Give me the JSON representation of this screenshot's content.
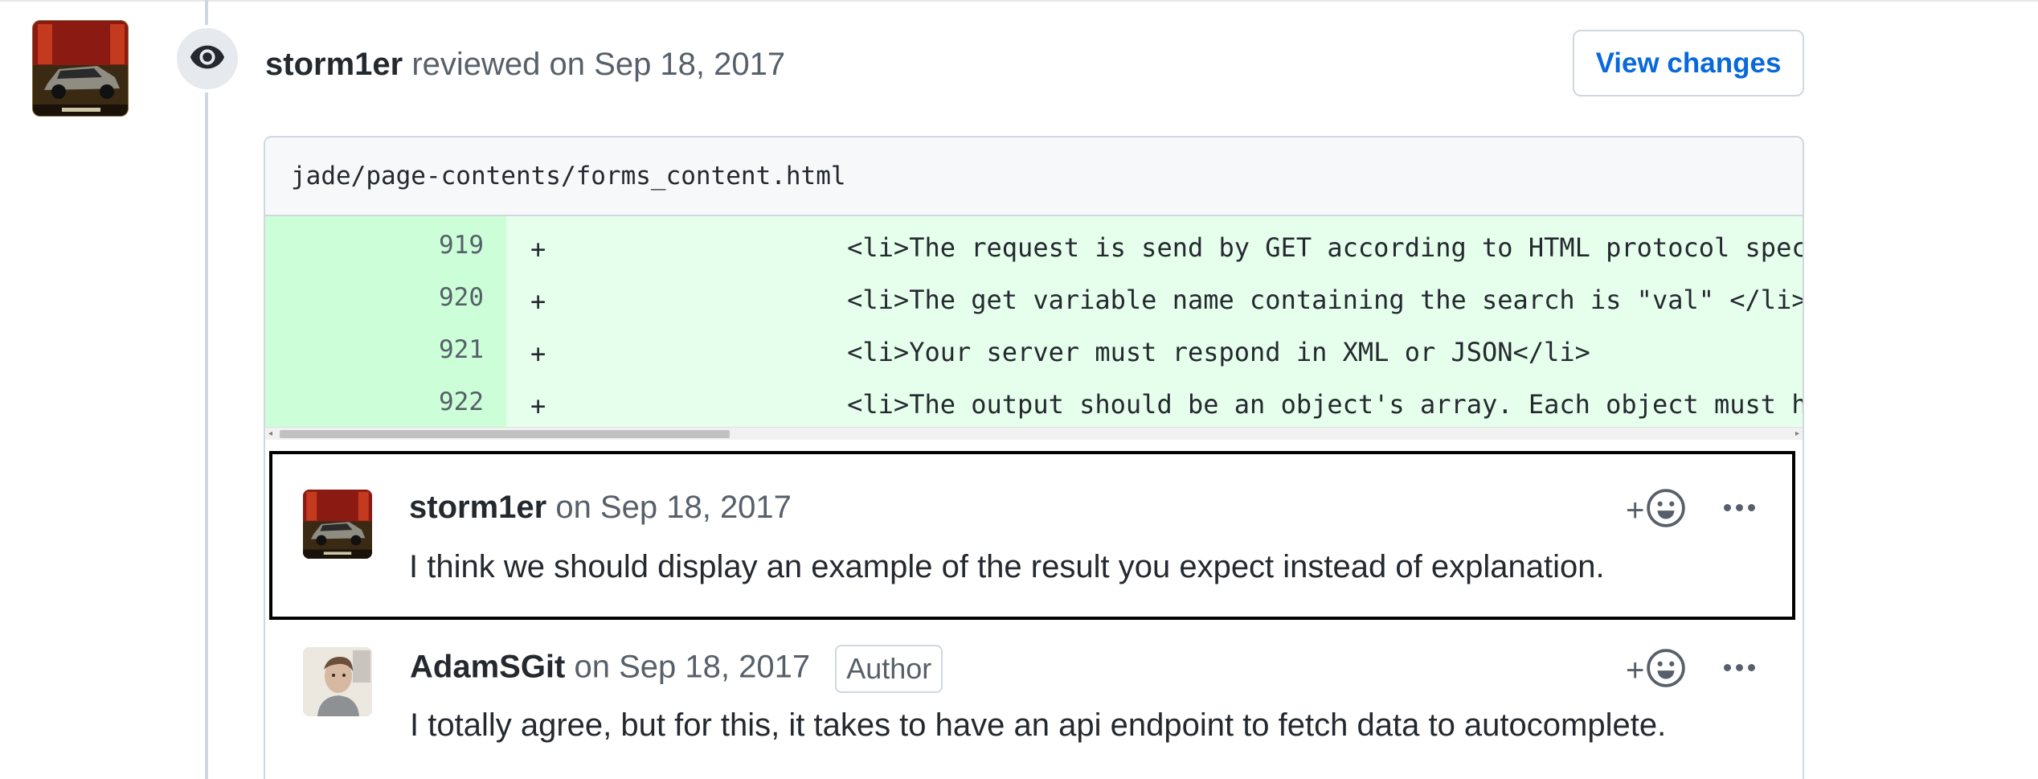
{
  "review": {
    "author": "storm1er",
    "action": "reviewed",
    "date": "on Sep 18, 2017",
    "view_changes_label": "View changes"
  },
  "file": {
    "path": "jade/page-contents/forms_content.html"
  },
  "diff_lines": [
    {
      "num": "919",
      "sign": "+",
      "code": "        <li>The request is send by GET according to HTML protocol spec for f"
    },
    {
      "num": "920",
      "sign": "+",
      "code": "        <li>The get variable name containing the search is \"val\" </li>"
    },
    {
      "num": "921",
      "sign": "+",
      "code": "        <li>Your server must respond in XML or JSON</li>"
    },
    {
      "num": "922",
      "sign": "+",
      "code": "        <li>The output should be an object's array. Each object must have at"
    }
  ],
  "comments": [
    {
      "author": "storm1er",
      "date": "on Sep 18, 2017",
      "body": "I think we should display an example of the result you expect instead of explanation."
    },
    {
      "author": "AdamSGit",
      "date": "on Sep 18, 2017",
      "badge": "Author",
      "body": "I totally agree, but for this, it takes to have an api endpoint to fetch data to autocomplete."
    }
  ],
  "icons": {
    "review_event": "eye-icon",
    "reaction": "smiley-icon",
    "more": "kebab-horizontal-icon"
  },
  "colors": {
    "link_blue": "#0969da",
    "diff_add_bg": "#e6ffec",
    "diff_add_gutter": "#ccffd8",
    "muted_text": "#57606a",
    "border": "#d0d7de"
  }
}
